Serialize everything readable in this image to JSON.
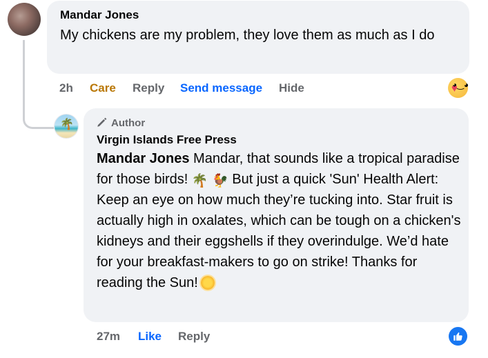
{
  "comment": {
    "author": "Mandar Jones",
    "text": "My chickens are my problem, they love them as much as I do",
    "actions": {
      "time": "2h",
      "reaction": "Care",
      "reply": "Reply",
      "send_message": "Send message",
      "hide": "Hide"
    },
    "reaction_icon": "care-emoji-icon"
  },
  "reply": {
    "badge": "Author",
    "author": "Virgin Islands Free Press",
    "mention": "Mandar Jones",
    "text_part1": " Mandar, that sounds like a tropical paradise for those birds! ",
    "emoji1": "🌴",
    "emoji2": "🐓",
    "text_part2": " But just a quick 'Sun' Health Alert: Keep an eye on how much they’re tucking into. Star fruit is actually high in oxalates, which can be tough on a chicken's kidneys and their eggshells if they overindulge. We’d hate for your breakfast-makers to go on strike! Thanks for reading the Sun!",
    "actions": {
      "time": "27m",
      "like": "Like",
      "reply": "Reply"
    },
    "reaction_icon": "like-icon",
    "colors": {
      "like_blue": "#0866ff",
      "care_gold": "#b97705"
    }
  }
}
